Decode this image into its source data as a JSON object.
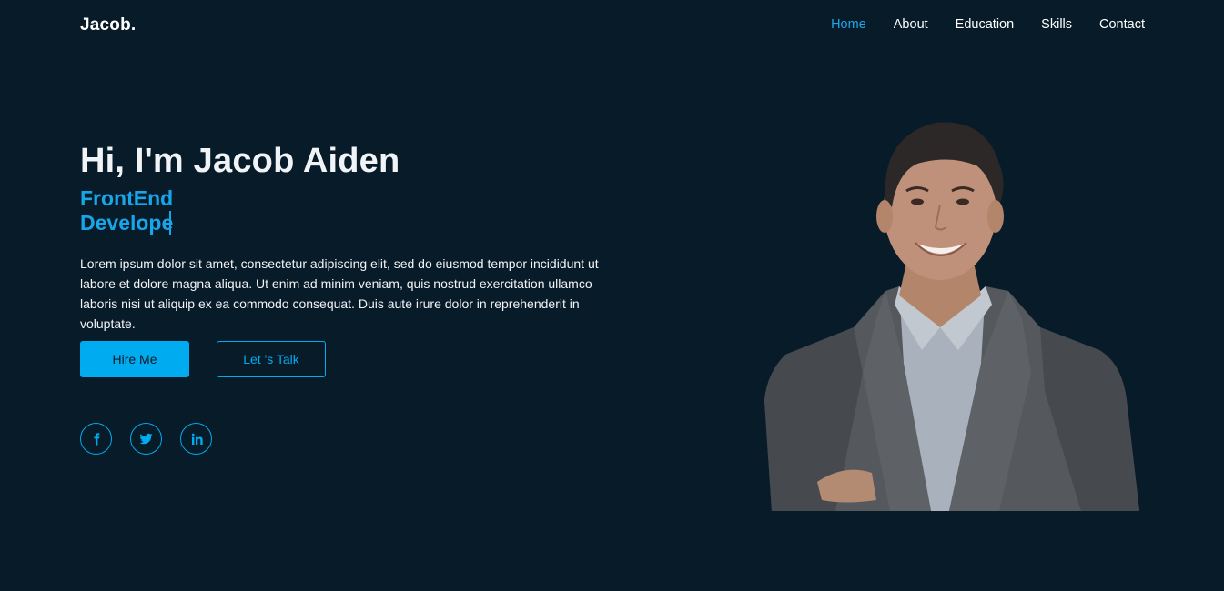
{
  "header": {
    "logo": "Jacob.",
    "nav": [
      {
        "label": "Home",
        "active": true
      },
      {
        "label": "About",
        "active": false
      },
      {
        "label": "Education",
        "active": false
      },
      {
        "label": "Skills",
        "active": false
      },
      {
        "label": "Contact",
        "active": false
      }
    ]
  },
  "hero": {
    "title": "Hi, I'm Jacob Aiden",
    "subtitle": "FrontEnd Develope",
    "description": "Lorem ipsum dolor sit amet, consectetur adipiscing elit, sed do eiusmod tempor incididunt ut labore et dolore magna aliqua. Ut enim ad minim veniam, quis nostrud exercitation ullamco laboris nisi ut aliquip ex ea commodo consequat. Duis aute irure dolor in reprehenderit in voluptate.",
    "buttons": {
      "primary": "Hire Me",
      "secondary": "Let 's Talk"
    },
    "socials": [
      {
        "icon": "facebook-icon"
      },
      {
        "icon": "twitter-icon"
      },
      {
        "icon": "linkedin-icon"
      }
    ]
  },
  "colors": {
    "background": "#081b29",
    "accent": "#00abf0",
    "text": "#ffffff"
  }
}
